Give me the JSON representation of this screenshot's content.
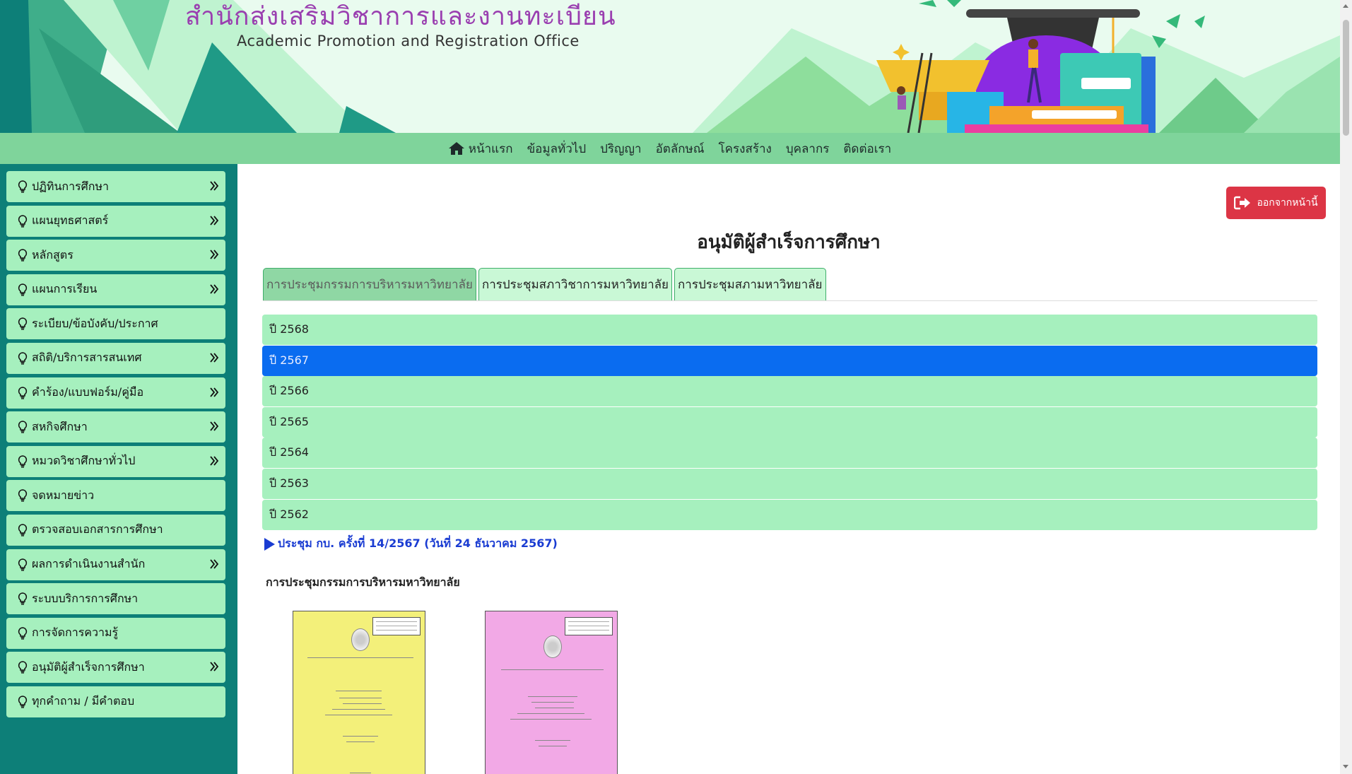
{
  "header": {
    "title_th": "สำนักส่งเสริมวิชาการและงานทะเบียน",
    "title_en": "Academic Promotion and Registration Office"
  },
  "topnav": {
    "items": [
      {
        "label": "หน้าแรก",
        "icon": "home-icon"
      },
      {
        "label": "ข้อมูลทั่วไป"
      },
      {
        "label": "ปริญญา"
      },
      {
        "label": "อัตลักษณ์"
      },
      {
        "label": "โครงสร้าง"
      },
      {
        "label": "บุคลากร"
      },
      {
        "label": "ติดต่อเรา"
      }
    ]
  },
  "sidebar": {
    "icon": "lightbulb-icon",
    "items": [
      {
        "label": "ปฏิทินการศึกษา",
        "expandable": true
      },
      {
        "label": "แผนยุทธศาสตร์",
        "expandable": true
      },
      {
        "label": "หลักสูตร",
        "expandable": true
      },
      {
        "label": "แผนการเรียน",
        "expandable": true
      },
      {
        "label": "ระเบียบ/ข้อบังคับ/ประกาศ",
        "expandable": false
      },
      {
        "label": "สถิติ/บริการสารสนเทศ",
        "expandable": true
      },
      {
        "label": "คำร้อง/แบบฟอร์ม/คู่มือ",
        "expandable": true
      },
      {
        "label": "สหกิจศึกษา",
        "expandable": true
      },
      {
        "label": "หมวดวิชาศึกษาทั่วไป",
        "expandable": true
      },
      {
        "label": "จดหมายข่าว",
        "expandable": false
      },
      {
        "label": "ตรวจสอบเอกสารการศึกษา",
        "expandable": false
      },
      {
        "label": "ผลการดำเนินงานสำนัก",
        "expandable": true
      },
      {
        "label": "ระบบบริการการศึกษา",
        "expandable": false
      },
      {
        "label": "การจัดการความรู้",
        "expandable": false
      },
      {
        "label": "อนุมัติผู้สำเร็จการศึกษา",
        "expandable": true
      },
      {
        "label": "ทุกคำถาม / มีคำตอบ",
        "expandable": false
      }
    ]
  },
  "main": {
    "logout_label": "ออกจากหน้านี้",
    "heading": "อนุมัติผู้สำเร็จการศึกษา",
    "tabs": [
      {
        "label": "การประชุมกรรมการบริหารมหาวิทยาลัย",
        "active": true
      },
      {
        "label": "การประชุมสภาวิชาการมหาวิทยาลัย",
        "active": false
      },
      {
        "label": "การประชุมสภามหาวิทยาลัย",
        "active": false
      }
    ],
    "years": [
      {
        "label": "ปี 2568",
        "active": false
      },
      {
        "label": "ปี 2567",
        "active": true
      },
      {
        "label": "ปี 2566",
        "active": false
      },
      {
        "label": "ปี 2565",
        "active": false
      },
      {
        "label": "ปี 2564",
        "active": false
      },
      {
        "label": "ปี 2563",
        "active": false
      },
      {
        "label": "ปี 2562",
        "active": false
      }
    ],
    "meeting_link": "ประชุม กบ. ครั้งที่ 14/2567 (วันที่ 24 ธันวาคม 2567)",
    "section_title": "การประชุมกรรมการบริหารมหาวิทยาลัย",
    "documents": [
      {
        "cover_color": "#f3f07a"
      },
      {
        "cover_color": "#f2a9e6"
      }
    ]
  },
  "colors": {
    "sidebar_bg": "#0d7f78",
    "item_bg": "#a6f0be",
    "nav_bg": "#7fd49b",
    "active_year": "#0a6cf0",
    "logout": "#dc3545",
    "title_purple": "#9a3fb0",
    "link_blue": "#1a3cd2"
  }
}
